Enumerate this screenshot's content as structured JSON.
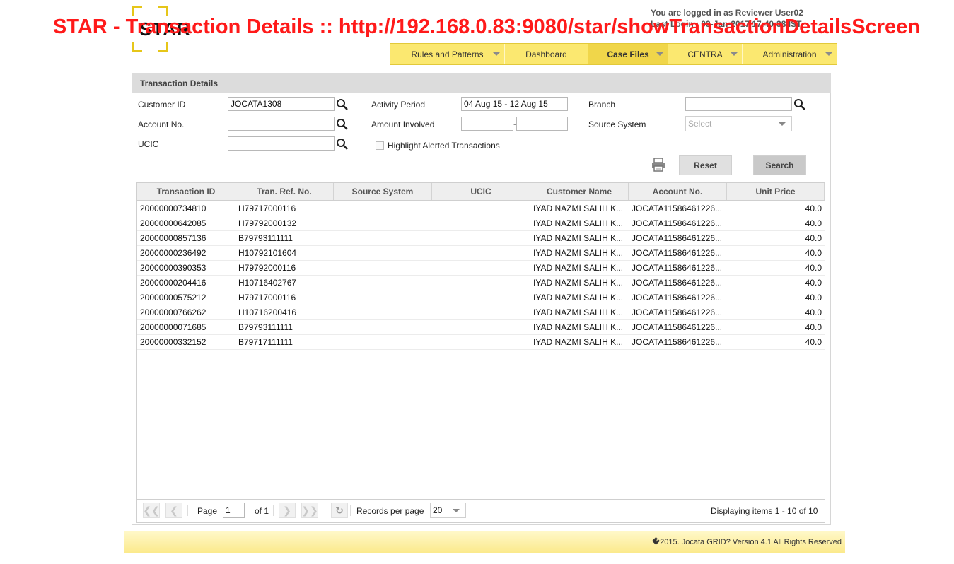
{
  "window_overlay_title": "STAR - Transaction Details :: http://192.168.0.83:9080/star/showTransactionDetailsScreen",
  "brand": {
    "logo_text": "STAR"
  },
  "session": {
    "logged_in_as": "You are logged in as Reviewer User02",
    "last_login": "Last Login : 03-Jan-2017 17:40:38 IST"
  },
  "nav": {
    "items": [
      {
        "label": "Rules and Patterns",
        "has_dropdown": true,
        "active": false
      },
      {
        "label": "Dashboard",
        "has_dropdown": false,
        "active": false
      },
      {
        "label": "Case Files",
        "has_dropdown": true,
        "active": true
      },
      {
        "label": "CENTRA",
        "has_dropdown": true,
        "active": false
      },
      {
        "label": "Administration",
        "has_dropdown": true,
        "active": false
      }
    ]
  },
  "panel": {
    "title": "Transaction Details"
  },
  "form": {
    "customer_id_label": "Customer ID",
    "customer_id_value": "JOCATA1308",
    "activity_period_label": "Activity Period",
    "activity_period_value": "04 Aug 15 - 12 Aug 15",
    "branch_label": "Branch",
    "branch_value": "",
    "account_no_label": "Account No.",
    "account_no_value": "",
    "amount_involved_label": "Amount Involved",
    "amount_from": "",
    "amount_separator": "-",
    "amount_to": "",
    "source_system_label": "Source System",
    "source_system_placeholder": "Select",
    "ucic_label": "UCIC",
    "ucic_value": "",
    "highlight_label": "Highlight Alerted Transactions",
    "reset_label": "Reset",
    "search_label": "Search"
  },
  "grid": {
    "columns": [
      "Transaction ID",
      "Tran. Ref. No.",
      "Source System",
      "UCIC",
      "Customer Name",
      "Account No.",
      "Unit Price"
    ],
    "rows": [
      [
        "20000000734810",
        "H79717000116",
        "",
        "",
        "IYAD NAZMI SALIH K...",
        "JOCATA11586461226...",
        "40.0"
      ],
      [
        "20000000642085",
        "H79792000132",
        "",
        "",
        "IYAD NAZMI SALIH K...",
        "JOCATA11586461226...",
        "40.0"
      ],
      [
        "20000000857136",
        "B79793111111",
        "",
        "",
        "IYAD NAZMI SALIH K...",
        "JOCATA11586461226...",
        "40.0"
      ],
      [
        "20000000236492",
        "H10792101604",
        "",
        "",
        "IYAD NAZMI SALIH K...",
        "JOCATA11586461226...",
        "40.0"
      ],
      [
        "20000000390353",
        "H79792000116",
        "",
        "",
        "IYAD NAZMI SALIH K...",
        "JOCATA11586461226...",
        "40.0"
      ],
      [
        "20000000204416",
        "H10716402767",
        "",
        "",
        "IYAD NAZMI SALIH K...",
        "JOCATA11586461226...",
        "40.0"
      ],
      [
        "20000000575212",
        "H79717000116",
        "",
        "",
        "IYAD NAZMI SALIH K...",
        "JOCATA11586461226...",
        "40.0"
      ],
      [
        "20000000766262",
        "H10716200416",
        "",
        "",
        "IYAD NAZMI SALIH K...",
        "JOCATA11586461226...",
        "40.0"
      ],
      [
        "20000000071685",
        "B79793111111",
        "",
        "",
        "IYAD NAZMI SALIH K...",
        "JOCATA11586461226...",
        "40.0"
      ],
      [
        "20000000332152",
        "B79717111111",
        "",
        "",
        "IYAD NAZMI SALIH K...",
        "JOCATA11586461226...",
        "40.0"
      ]
    ]
  },
  "pager": {
    "page_label": "Page",
    "page_value": "1",
    "of_label": "of 1",
    "records_label": "Records per page",
    "records_value": "20",
    "displaying": "Displaying items 1 - 10 of 10"
  },
  "footer": {
    "copyright": "�2015. Jocata GRID? Version 4.1 All Rights Reserved"
  },
  "colors": {
    "nav_bg": "#fbe870",
    "nav_active": "#f0d64a",
    "overlay_title": "#ff1a1a",
    "logo_frame": "#e6c619"
  },
  "icons": [
    "search-icon",
    "print-icon",
    "first-page-icon",
    "prev-page-icon",
    "next-page-icon",
    "last-page-icon",
    "refresh-icon",
    "chevron-down-icon"
  ]
}
